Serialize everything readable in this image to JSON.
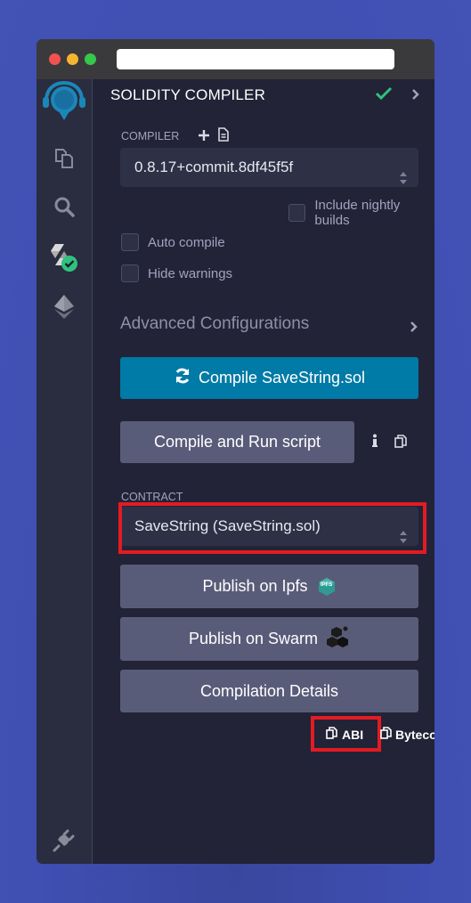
{
  "window": {
    "url_bar_value": ""
  },
  "sidebar": {
    "icons": [
      {
        "name": "remix-logo-icon"
      },
      {
        "name": "file-explorer-icon"
      },
      {
        "name": "search-icon"
      },
      {
        "name": "solidity-compiler-icon",
        "status": "success"
      },
      {
        "name": "deploy-run-icon"
      },
      {
        "name": "plugin-manager-icon"
      }
    ]
  },
  "panel": {
    "title": "SOLIDITY COMPILER",
    "compiler_label": "COMPILER",
    "compiler_version": "0.8.17+commit.8df45f5f",
    "include_nightly_label": "Include nightly builds",
    "include_nightly_checked": false,
    "auto_compile_label": "Auto compile",
    "auto_compile_checked": false,
    "hide_warnings_label": "Hide warnings",
    "hide_warnings_checked": false,
    "advanced_label": "Advanced Configurations",
    "compile_button": "Compile SaveString.sol",
    "compile_run_button": "Compile and Run script",
    "contract_label": "CONTRACT",
    "contract_selected": "SaveString (SaveString.sol)",
    "publish_ipfs_button": "Publish on Ipfs",
    "ipfs_badge": "IPFS",
    "publish_swarm_button": "Publish on Swarm",
    "compilation_details_button": "Compilation Details",
    "abi_link": "ABI",
    "bytecode_link": "Bytecode"
  },
  "colors": {
    "accent_primary": "#007aa6",
    "button_secondary": "#595c79",
    "success": "#2ec27e",
    "highlight_box": "#e31b23",
    "background": "#3f4fb2"
  }
}
